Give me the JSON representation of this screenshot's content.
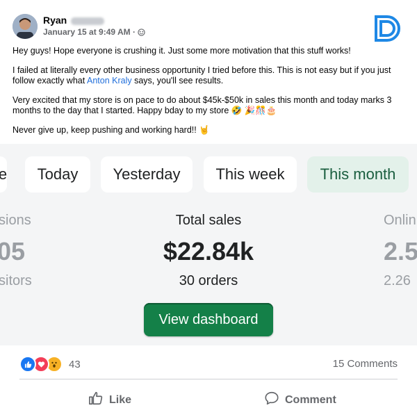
{
  "post": {
    "author": "Ryan",
    "timestamp": "January 15 at 9:49 AM",
    "audience_icon": "globe-icon",
    "paragraphs": {
      "p1": "Hey guys! Hope everyone is crushing it. Just some more motivation that this stuff works!",
      "p2_before": "I failed at literally every other business opportunity I tried before this. This is not easy but if you just follow exactly what ",
      "p2_link": "Anton Kraly",
      "p2_after": " says, you'll see results.",
      "p3": "Very excited that my store is on pace to do about $45k-$50k in sales this month and today marks 3 months to the day that I started. Happy bday to my store 🤣 🎉🎊🎂",
      "p4": "Never give up, keep pushing and working hard!! 🤘"
    }
  },
  "card": {
    "tabs": {
      "partial": "e",
      "today": "Today",
      "yesterday": "Yesterday",
      "this_week": "This week",
      "this_month": "This month"
    },
    "active_tab": "This month",
    "left_metric": {
      "label": "sions",
      "value": "05",
      "sub": "sitors"
    },
    "center_metric": {
      "label": "Total sales",
      "value": "$22.84k",
      "sub": "30 orders"
    },
    "right_metric": {
      "label": "Onlin",
      "value": "2.5",
      "sub": "2.26"
    },
    "view_button": "View dashboard",
    "accent_color": "#148048"
  },
  "footer": {
    "reaction_icons": [
      "like-icon",
      "love-icon",
      "wow-icon"
    ],
    "reaction_count": "43",
    "comments": "15 Comments",
    "like_label": "Like",
    "comment_label": "Comment"
  }
}
